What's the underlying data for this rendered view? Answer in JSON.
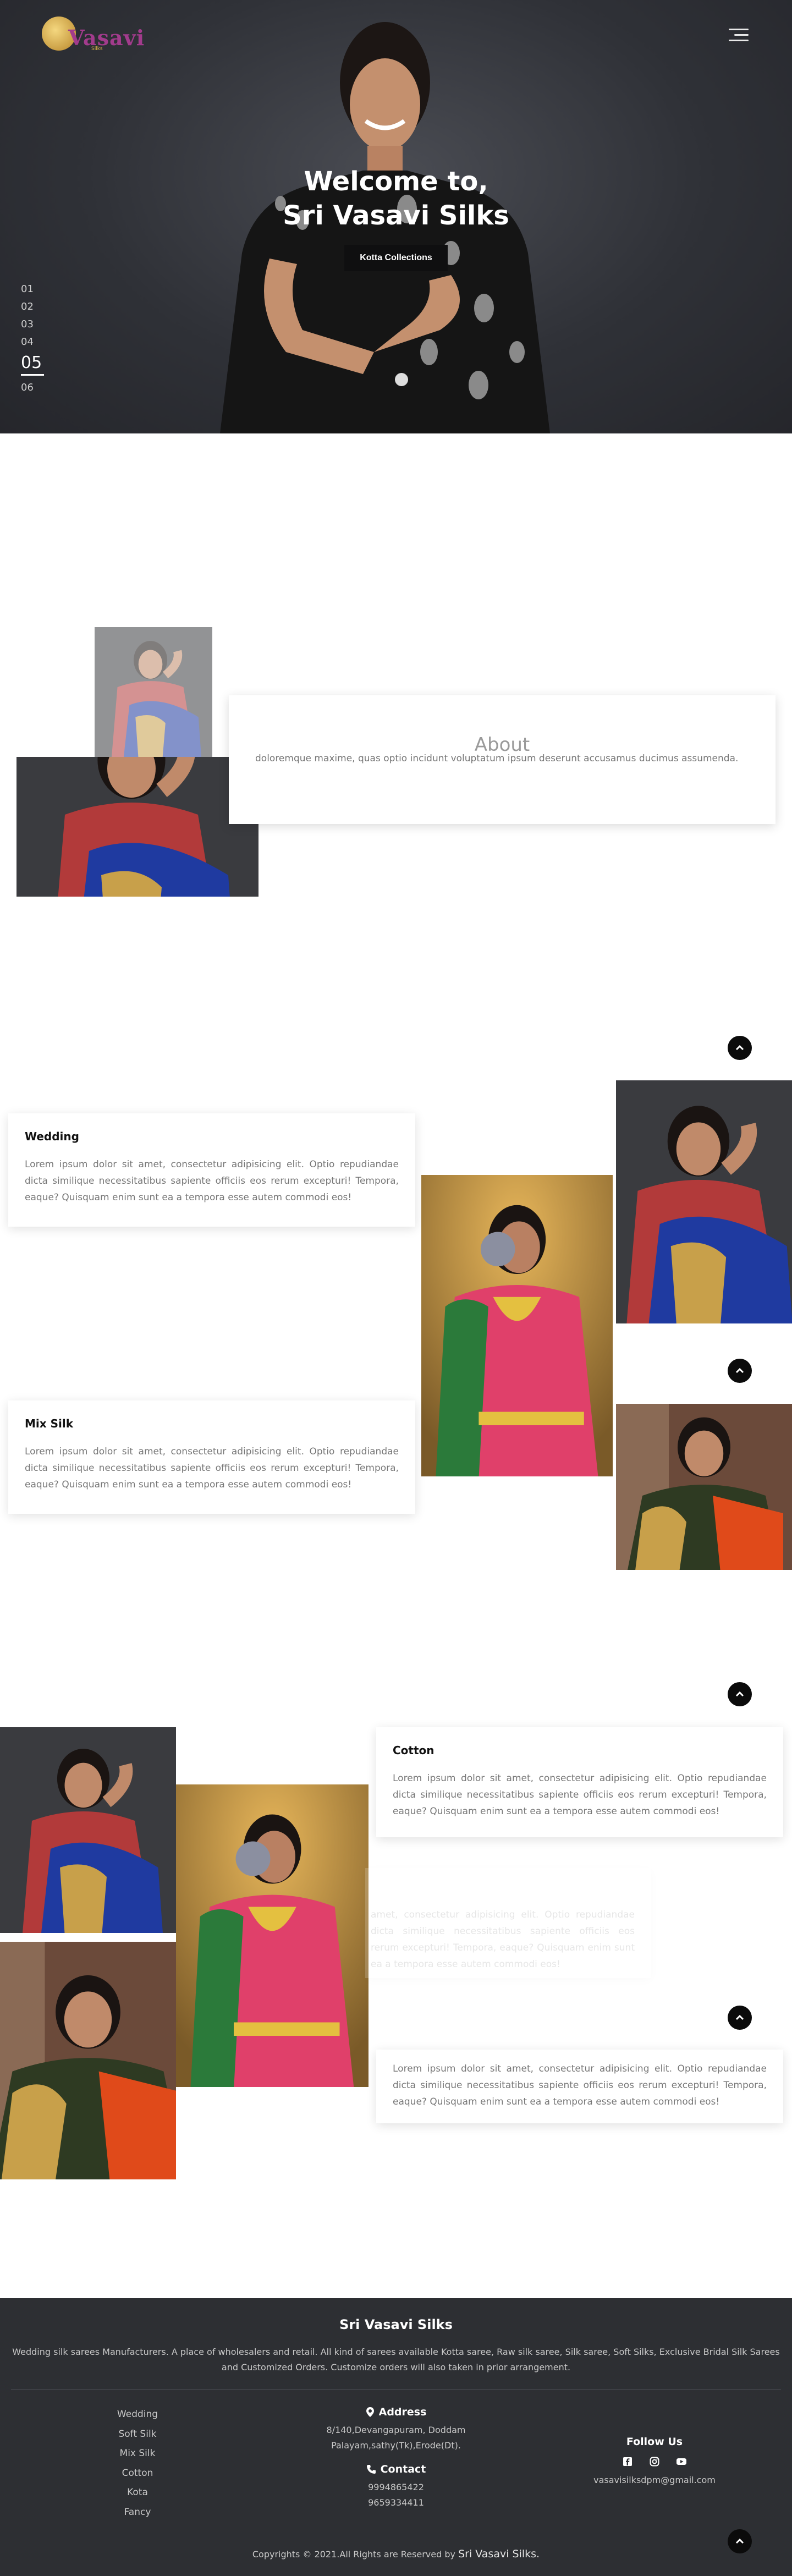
{
  "brand": {
    "logo_text": "Vasavi",
    "logo_sub": "Silks"
  },
  "hero": {
    "title_line1": "Welcome to,",
    "title_line2": "Sri Vasavi Silks",
    "cta_label": "Kotta Collections",
    "slides": [
      "01",
      "02",
      "03",
      "04",
      "05",
      "06"
    ],
    "active_slide": "05"
  },
  "about": {
    "title": "About",
    "text": "doloremque maxime, quas optio incidunt voluptatum ipsum deserunt accusamus ducimus assumenda."
  },
  "categories": [
    {
      "title": "Wedding",
      "text": "Lorem ipsum dolor sit amet, consectetur adipisicing elit. Optio repudiandae dicta similique necessitatibus sapiente officiis eos rerum excepturi! Tempora, eaque? Quisquam enim sunt ea a tempora esse autem commodi eos!"
    },
    {
      "title": "Mix Silk",
      "text": "Lorem ipsum dolor sit amet, consectetur adipisicing elit. Optio repudiandae dicta similique necessitatibus sapiente officiis eos rerum excepturi! Tempora, eaque? Quisquam enim sunt ea a tempora esse autem commodi eos!"
    },
    {
      "title": "Cotton",
      "text": "Lorem ipsum dolor sit amet, consectetur adipisicing elit. Optio repudiandae dicta similique necessitatibus sapiente officiis eos rerum excepturi! Tempora, eaque? Quisquam enim sunt ea a tempora esse autem commodi eos!"
    },
    {
      "title": "",
      "text": "amet, consectetur adipisicing elit. Optio repudiandae dicta similique necessitatibus sapiente officiis eos rerum excepturi! Tempora, eaque? Quisquam enim sunt ea a tempora esse autem commodi eos!"
    },
    {
      "title": "",
      "text": "Lorem ipsum dolor sit amet, consectetur adipisicing elit. Optio repudiandae dicta similique necessitatibus sapiente officiis eos rerum excepturi! Tempora, eaque? Quisquam enim sunt ea a tempora esse autem commodi eos!"
    }
  ],
  "footer": {
    "title": "Sri Vasavi Silks",
    "description": "Wedding silk sarees Manufacturers. A place of wholesalers and retail. All kind of sarees available Kotta saree, Raw silk saree, Silk saree, Soft Silks, Exclusive Bridal Silk Sarees and Customized Orders. Customize orders will also taken in prior arrangement.",
    "links": [
      "Wedding",
      "Soft Silk",
      "Mix Silk",
      "Cotton",
      "Kota",
      "Fancy"
    ],
    "address_heading": "Address",
    "address_lines": [
      "8/140,Devangapuram, Doddam",
      "Palayam,sathy(Tk),Erode(Dt)."
    ],
    "contact_heading": "Contact",
    "phones": [
      "9994865422",
      "9659334411"
    ],
    "follow_heading": "Follow Us",
    "email": "vasavisilksdpm@gmail.com",
    "social_icons": [
      "facebook-icon",
      "instagram-icon",
      "youtube-icon"
    ],
    "copyright_prefix": "Copyrights © 2021.All Rights are Reserved by ",
    "copyright_brand": "Sri Vasavi Silks."
  },
  "colors": {
    "accent": "#a23b8c",
    "gold": "#d8b24a",
    "footer_bg": "#2d2f33",
    "dark": "#0b0b0b"
  }
}
